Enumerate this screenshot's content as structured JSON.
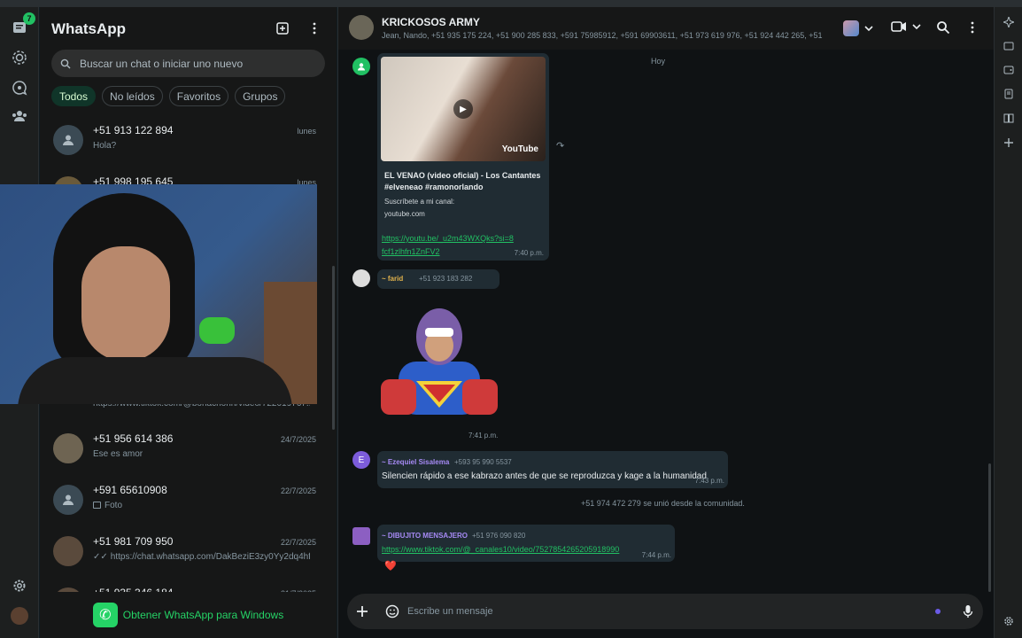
{
  "rail": {
    "unread_count": "7"
  },
  "sidebar": {
    "title": "WhatsApp",
    "search_placeholder": "Buscar un chat o iniciar uno nuevo",
    "filters": [
      "Todos",
      "No leídos",
      "Favoritos",
      "Grupos"
    ],
    "chats": [
      {
        "name": "+51 913 122 894",
        "preview": "Hola?",
        "time": "lunes"
      },
      {
        "name": "+51 998 195 645",
        "preview": "",
        "time": "lunes"
      },
      {
        "name": "",
        "preview": "https://www.tiktok.com/@bonachonn/video/722019767...",
        "time": ""
      },
      {
        "name": "+51 956 614 386",
        "preview": "Ese es amor",
        "time": "24/7/2025"
      },
      {
        "name": "+591 65610908",
        "preview": "Foto",
        "time": "22/7/2025"
      },
      {
        "name": "+51 981 709 950",
        "preview": "https://chat.whatsapp.com/DakBeziE3zy0Yy2dq4hfJA...",
        "time": "22/7/2025"
      },
      {
        "name": "+51 935 346 184",
        "preview": "",
        "time": "21/7/2025"
      }
    ],
    "get_app": "Obtener WhatsApp para Windows"
  },
  "chat": {
    "group_name": "KRICKOSOS ARMY",
    "members": "Jean, Nando, +51 935 175 224, +51 900 285 833, +591 75985912, +591 69903611, +51 973 619 976, +51 924 442 265, +51 ...",
    "day_label": "Hoy",
    "messages": {
      "m1": {
        "preview_title": "EL VENAO (video oficial) - Los Cantantes #elveneao #ramonorlando",
        "preview_desc": "Suscríbete a mi canal:",
        "preview_domain": "youtube.com",
        "video_brand": "YouTube",
        "link": "https://youtu.be/_u2m43WXQks?si=8fcf1zlhfn1ZnFV2",
        "time": "7:40 p.m."
      },
      "m2": {
        "sender": "~ farid",
        "phone": "+51 923 183 282",
        "time": "7:41 p.m."
      },
      "m3": {
        "avatar_letter": "E",
        "sender": "~ Ezequiel Sisalema",
        "phone": "+593 95 990 5537",
        "text": "Silencien rápido a ese kabrazo antes de que se reproduzca y kage a la humanidad",
        "time": "7:43 p.m."
      },
      "system": "+51 974 472 279 se unió desde la comunidad.",
      "m4": {
        "sender": "~ DIBUJITO MENSAJERO",
        "phone": "+51 976 090 820",
        "link": "https://www.tiktok.com/@_canales10/video/7527854265205918990",
        "time": "7:44 p.m.",
        "reaction": "❤️"
      }
    },
    "composer_placeholder": "Escribe un mensaje"
  }
}
